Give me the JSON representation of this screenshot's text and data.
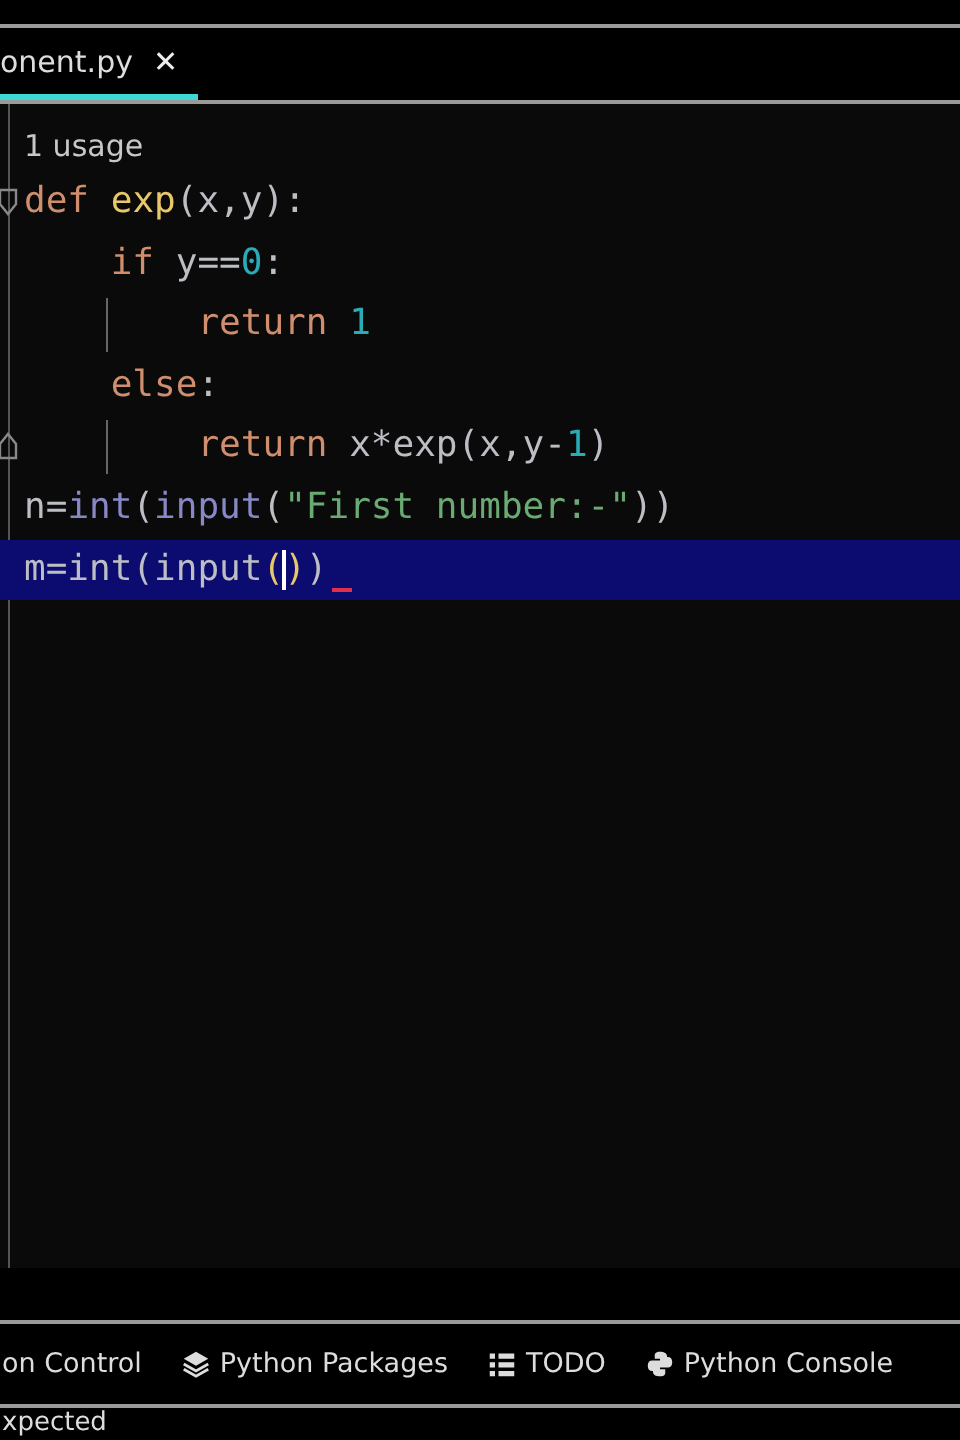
{
  "tab": {
    "title": "onent.py",
    "selected": true,
    "close": "✕"
  },
  "editor": {
    "hint": "1 usage",
    "lines": [
      {
        "kind": "opener",
        "selected": false,
        "guide": false,
        "error": false,
        "tokens": [
          {
            "kind": "kw",
            "text": "def "
          },
          {
            "kind": "fn",
            "text": "exp"
          },
          {
            "kind": "plain",
            "text": "(x,y):"
          }
        ]
      },
      {
        "kind": "code",
        "selected": false,
        "guide": false,
        "error": false,
        "tokens": [
          {
            "kind": "kw",
            "text": "    if "
          },
          {
            "kind": "plain",
            "text": "y=="
          },
          {
            "kind": "num",
            "text": "0"
          },
          {
            "kind": "plain",
            "text": ":"
          }
        ]
      },
      {
        "kind": "code",
        "selected": false,
        "guide": true,
        "error": false,
        "tokens": [
          {
            "kind": "kw",
            "text": "        return "
          },
          {
            "kind": "num",
            "text": "1"
          }
        ]
      },
      {
        "kind": "code",
        "selected": false,
        "guide": false,
        "error": false,
        "tokens": [
          {
            "kind": "kw",
            "text": "    else"
          },
          {
            "kind": "plain",
            "text": ":"
          }
        ]
      },
      {
        "kind": "closer",
        "selected": false,
        "guide": true,
        "error": false,
        "tokens": [
          {
            "kind": "kw",
            "text": "        return "
          },
          {
            "kind": "plain",
            "text": "x*exp(x,y-"
          },
          {
            "kind": "num",
            "text": "1"
          },
          {
            "kind": "plain",
            "text": ")"
          }
        ]
      },
      {
        "kind": "code",
        "selected": false,
        "guide": false,
        "error": false,
        "tokens": [
          {
            "kind": "plain",
            "text": "n="
          },
          {
            "kind": "builtin",
            "text": "int"
          },
          {
            "kind": "plain",
            "text": "("
          },
          {
            "kind": "builtin",
            "text": "input"
          },
          {
            "kind": "plain",
            "text": "("
          },
          {
            "kind": "str",
            "text": "\"First number:-\""
          },
          {
            "kind": "plain",
            "text": "))"
          }
        ]
      },
      {
        "kind": "code",
        "selected": true,
        "guide": false,
        "error": true,
        "tokens": [
          {
            "kind": "plain",
            "text": "m=int(input"
          },
          {
            "kind": "brace",
            "text": "("
          },
          {
            "kind": "brace",
            "text": ")",
            "caret": true
          },
          {
            "kind": "plain",
            "text": ")"
          }
        ]
      }
    ]
  },
  "tool_tabs": [
    {
      "kind": "text",
      "label": "on Control"
    },
    {
      "kind": "packages",
      "label": "Python Packages"
    },
    {
      "kind": "todo",
      "label": "TODO"
    },
    {
      "kind": "console",
      "label": "Python Console"
    }
  ],
  "status": "xpected"
}
